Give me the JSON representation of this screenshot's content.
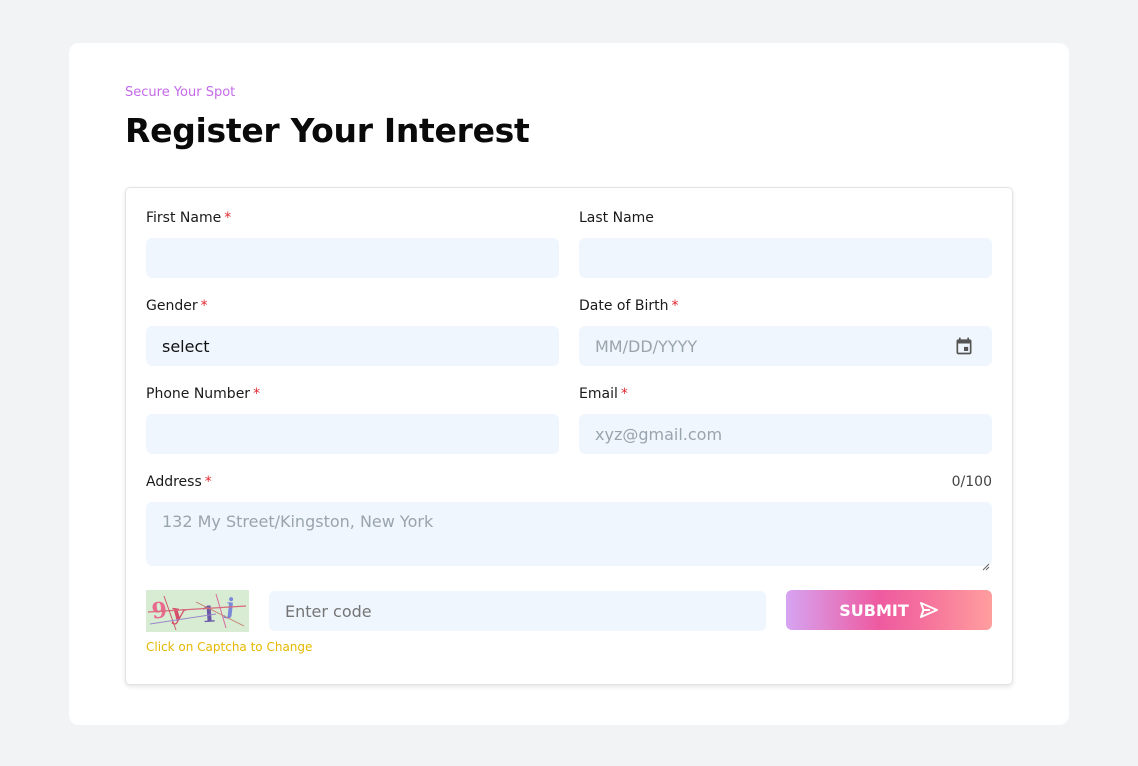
{
  "header": {
    "eyebrow": "Secure Your Spot",
    "title": "Register Your Interest"
  },
  "form": {
    "first_name": {
      "label": "First Name",
      "required": "*",
      "value": ""
    },
    "last_name": {
      "label": "Last Name",
      "value": ""
    },
    "gender": {
      "label": "Gender",
      "required": "*",
      "value": "select"
    },
    "dob": {
      "label": "Date of Birth",
      "required": "*",
      "placeholder": "MM/DD/YYYY",
      "icon": "calendar-icon"
    },
    "phone": {
      "label": "Phone Number",
      "required": "*",
      "value": ""
    },
    "email": {
      "label": "Email",
      "required": "*",
      "placeholder": "xyz@gmail.com"
    },
    "address": {
      "label": "Address",
      "required": "*",
      "counter": "0/100",
      "placeholder": "132 My Street/Kingston, New York"
    },
    "captcha": {
      "text": "9y1j",
      "hint": "Click on Captcha to Change",
      "placeholder": "Enter code"
    },
    "submit": {
      "label": "SUBMIT",
      "icon": "send-icon"
    }
  },
  "colors": {
    "page_bg": "#f2f3f5",
    "input_bg": "#eff6fd",
    "eyebrow": "#c46ae8",
    "required": "#e0282e",
    "hint": "#e6b800",
    "submit_gradient": [
      "#d6a4f2",
      "#ee5aa0",
      "#ff9e9e"
    ]
  }
}
